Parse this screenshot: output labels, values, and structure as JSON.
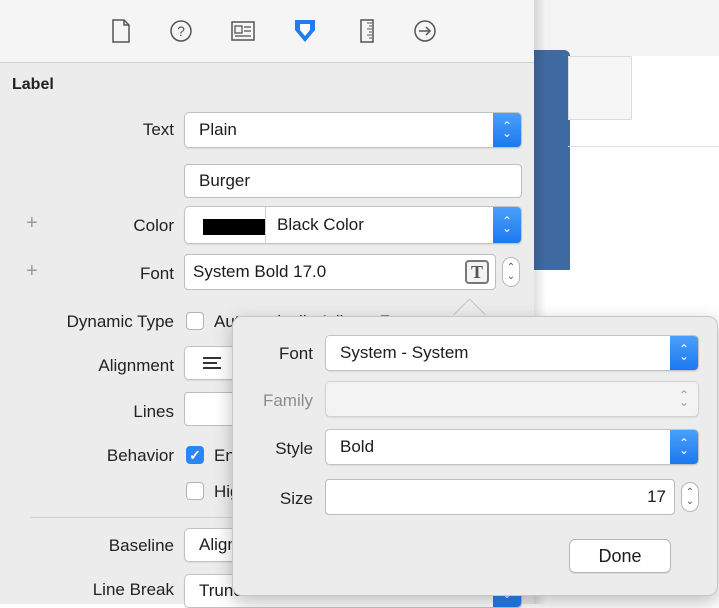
{
  "toolbar": {
    "icons": [
      "file-inspector-icon",
      "quick-help-icon",
      "identity-inspector-icon",
      "attributes-inspector-icon",
      "size-inspector-icon",
      "connections-inspector-icon"
    ],
    "active_color": "#1f7cf2"
  },
  "section": {
    "title": "Label"
  },
  "fields": {
    "text_label": "Text",
    "text_type": "Plain",
    "text_value": "Burger",
    "color_label": "Color",
    "color_value": "Black Color",
    "font_label": "Font",
    "font_value": "System Bold 17.0",
    "font_icon_glyph": "T",
    "dynamic_type_label": "Dynamic Type",
    "dynamic_type_value": "Automatically Adjusts Font",
    "alignment_label": "Alignment",
    "lines_label": "Lines",
    "behavior_label": "Behavior",
    "behavior_enabled": "Enabled",
    "behavior_highlighted": "Highlighted",
    "baseline_label": "Baseline",
    "baseline_value": "Align Baselines",
    "line_break_label": "Line Break",
    "line_break_value": "Truncate Tail",
    "plus": "+"
  },
  "popover": {
    "font_label": "Font",
    "font_value": "System - System",
    "family_label": "Family",
    "family_value": "",
    "style_label": "Style",
    "style_value": "Bold",
    "size_label": "Size",
    "size_value": "17",
    "done_label": "Done"
  },
  "colors": {
    "accent": "#1f7cf2",
    "canvas_bar": "#3f6aa1"
  }
}
